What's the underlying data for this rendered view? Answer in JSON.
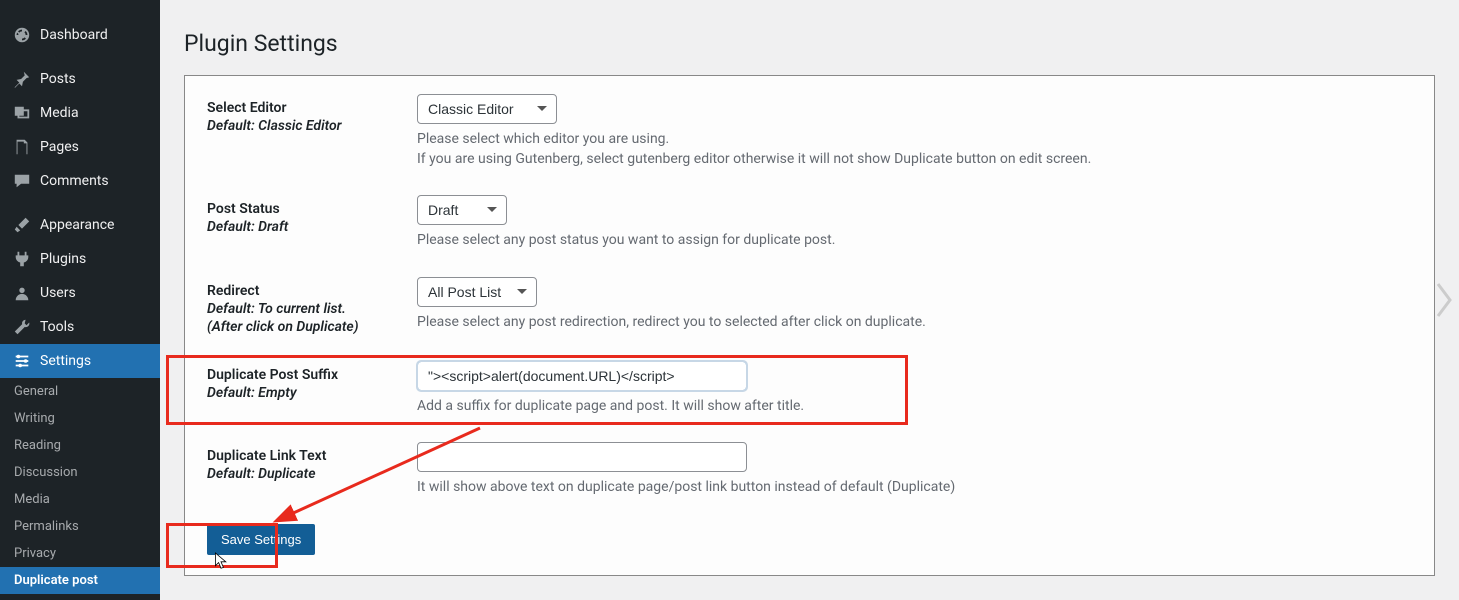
{
  "sidebar": {
    "items": [
      {
        "label": "Dashboard"
      },
      {
        "label": "Posts"
      },
      {
        "label": "Media"
      },
      {
        "label": "Pages"
      },
      {
        "label": "Comments"
      },
      {
        "label": "Appearance"
      },
      {
        "label": "Plugins"
      },
      {
        "label": "Users"
      },
      {
        "label": "Tools"
      },
      {
        "label": "Settings"
      }
    ],
    "sub_items": [
      {
        "label": "General"
      },
      {
        "label": "Writing"
      },
      {
        "label": "Reading"
      },
      {
        "label": "Discussion"
      },
      {
        "label": "Media"
      },
      {
        "label": "Permalinks"
      },
      {
        "label": "Privacy"
      },
      {
        "label": "Duplicate post"
      }
    ]
  },
  "page": {
    "title": "Plugin Settings"
  },
  "fields": {
    "editor": {
      "label": "Select Editor",
      "default": "Default: Classic Editor",
      "value": "Classic Editor",
      "desc1": "Please select which editor you are using.",
      "desc2": "If you are using Gutenberg, select gutenberg editor otherwise it will not show Duplicate button on edit screen."
    },
    "status": {
      "label": "Post Status",
      "default": "Default: Draft",
      "value": "Draft",
      "desc": "Please select any post status you want to assign for duplicate post."
    },
    "redirect": {
      "label": "Redirect",
      "default": "Default: To current list.",
      "default2": "(After click on Duplicate)",
      "value": "All Post List",
      "desc": "Please select any post redirection, redirect you to selected after click on duplicate."
    },
    "suffix": {
      "label": "Duplicate Post Suffix",
      "default": "Default: Empty",
      "value": "\"><script>alert(document.URL)</script>",
      "desc": "Add a suffix for duplicate page and post. It will show after title."
    },
    "link_text": {
      "label": "Duplicate Link Text",
      "default": "Default: Duplicate",
      "value": "",
      "desc": "It will show above text on duplicate page/post link button instead of default (Duplicate)"
    }
  },
  "buttons": {
    "save": "Save Settings"
  }
}
